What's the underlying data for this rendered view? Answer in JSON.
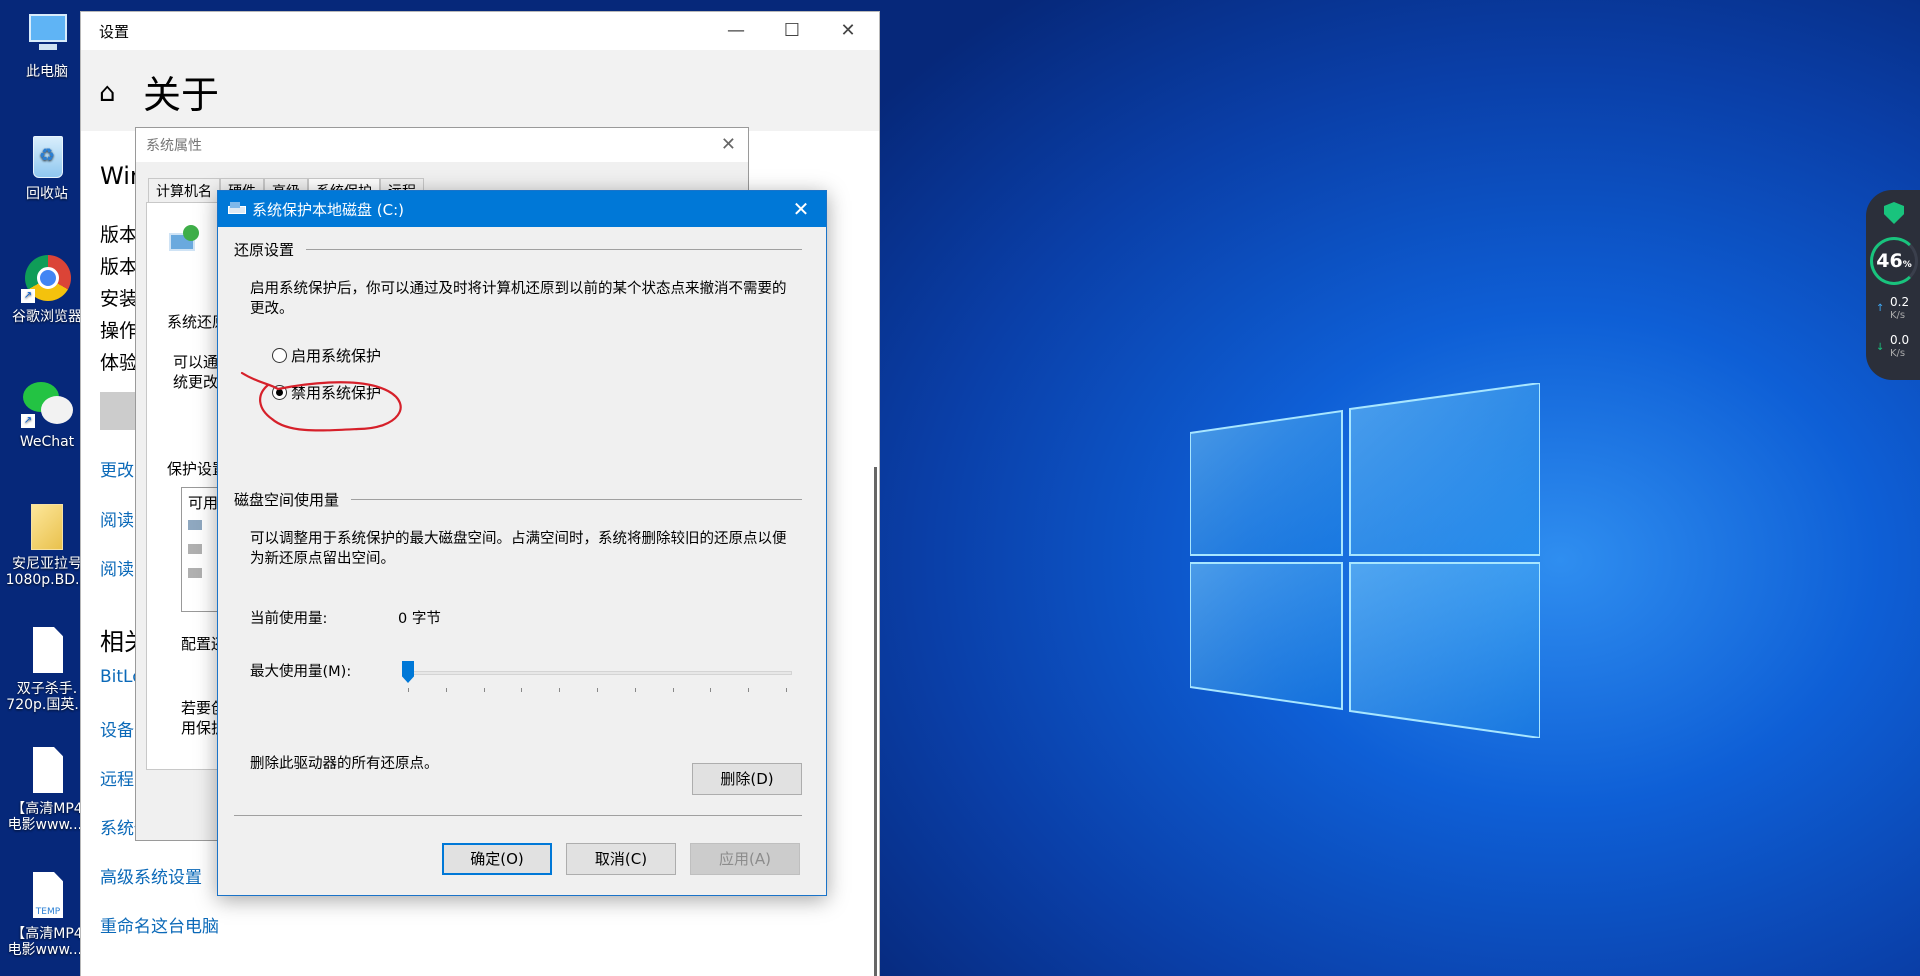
{
  "desktop": {
    "icons": [
      {
        "label": "此电脑"
      },
      {
        "label": "回收站"
      },
      {
        "label": "谷歌浏览器"
      },
      {
        "label": "WeChat"
      },
      {
        "label": "安尼亚拉号\n1080p.BD..."
      },
      {
        "label": "双子杀手.\n720p.国英..."
      },
      {
        "label": "【高清MP4\n电影www...."
      },
      {
        "label": "【高清MP4\n电影www...."
      }
    ],
    "temp_label": "TEMP"
  },
  "settings": {
    "window_title": "设置",
    "page_title": "关于",
    "fragments": [
      "Win",
      "版本",
      "版本",
      "安装",
      "操作",
      "体验",
      "相关"
    ],
    "links": [
      "更改",
      "阅读",
      "阅读",
      "BitLo",
      "设备",
      "远程",
      "系统保",
      "高级系统设置",
      "重命名这台电脑"
    ]
  },
  "sysprop": {
    "title": "系统属性",
    "tabs": [
      "计算机名",
      "硬件",
      "高级",
      "系统保护",
      "远程"
    ],
    "fragments": [
      "系统还原",
      "可以通",
      "统更改",
      "保护设置",
      "可用",
      "配置还",
      "若要创",
      "用保护"
    ]
  },
  "dialog": {
    "title": "系统保护本地磁盘 (C:)",
    "restore_group": "还原设置",
    "restore_desc": "启用系统保护后，你可以通过及时将计算机还原到以前的某个状态点来撤消不需要的更改。",
    "radio_enable": "启用系统保护",
    "radio_disable": "禁用系统保护",
    "selected": "禁用系统保护",
    "disk_group": "磁盘空间使用量",
    "disk_desc": "可以调整用于系统保护的最大磁盘空间。占满空间时，系统将删除较旧的还原点以便为新还原点留出空间。",
    "current_usage_label": "当前使用量:",
    "current_usage_value": "0 字节",
    "max_usage_label": "最大使用量(M):",
    "max_usage_slider": 0,
    "delete_desc": "删除此驱动器的所有还原点。",
    "delete_button": "删除(D)",
    "ok_button": "确定(O)",
    "cancel_button": "取消(C)",
    "apply_button": "应用(A)"
  },
  "widget": {
    "percent": "46",
    "percent_unit": "%",
    "upload": "0.2",
    "download": "0.0",
    "unit": "K/s"
  },
  "colors": {
    "accent": "#0078d7",
    "link": "#0b69b8",
    "annotation": "#d6202a",
    "widget_green": "#19c37d"
  }
}
